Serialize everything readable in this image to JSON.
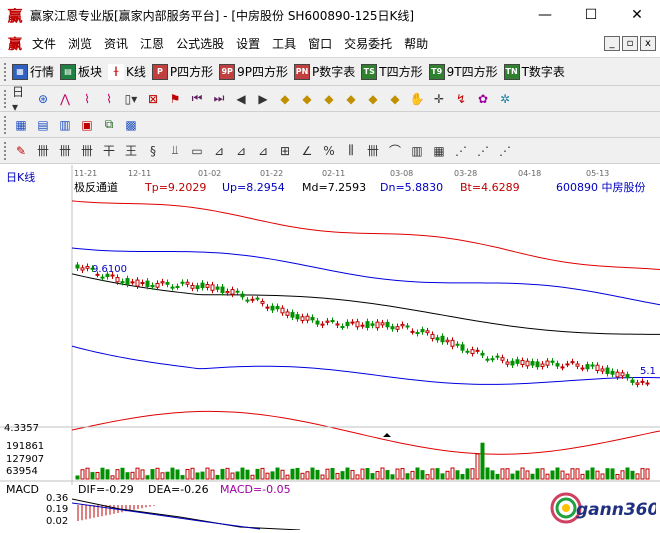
{
  "window": {
    "title": "赢家江恩专业版[赢家内部服务平台] - [中房股份  SH600890-125日K线]",
    "minimize": "—",
    "maximize": "☐",
    "close": "✕"
  },
  "menu": {
    "items": [
      "文件",
      "浏览",
      "资讯",
      "江恩",
      "公式选股",
      "设置",
      "工具",
      "窗口",
      "交易委托",
      "帮助"
    ],
    "mdi": [
      "_",
      "▫",
      "x"
    ]
  },
  "toolbar1": {
    "items": [
      {
        "label": "行情",
        "icon": "grid-icon"
      },
      {
        "label": "板块",
        "icon": "blocks-icon"
      },
      {
        "label": "K线",
        "icon": "candlestick-icon"
      },
      {
        "label": "P四方形",
        "icon": "P"
      },
      {
        "label": "9P四方形",
        "icon": "9P"
      },
      {
        "label": "P数字表",
        "icon": "PN"
      },
      {
        "label": "T四方形",
        "icon": "TS"
      },
      {
        "label": "9T四方形",
        "icon": "T9"
      },
      {
        "label": "T数字表",
        "icon": "TN"
      }
    ]
  },
  "chart": {
    "period_label": "日K线",
    "date_ticks": [
      "11-21",
      "12-11",
      "01-02",
      "01-22",
      "02-11",
      "03-08",
      "03-28",
      "04-18",
      "05-13"
    ],
    "indicator_name": "极反通道",
    "tp": "Tp=9.2029",
    "up": "Up=8.2954",
    "md": "Md=7.2593",
    "dn": "Dn=5.8830",
    "bt": "Bt=4.6289",
    "stock": "600890  中房股份",
    "price_label_left": "9.6100",
    "price_label_right": "5.1",
    "low_price": "4.3357",
    "volume_ticks": [
      "191861",
      "127907",
      "63954"
    ],
    "macd": {
      "title": "MACD",
      "dif": "DIF=-0.29",
      "dea": "DEA=-0.26",
      "macd": "MACD=-0.05",
      "ticks": [
        "0.36",
        "0.19",
        "0.02"
      ]
    },
    "logo_text": "gann360"
  },
  "colors": {
    "up_candle": "#c00000",
    "down_candle": "#009000",
    "channel_red": "#e00000",
    "channel_blue": "#0000e0",
    "mid_black": "#000000"
  }
}
